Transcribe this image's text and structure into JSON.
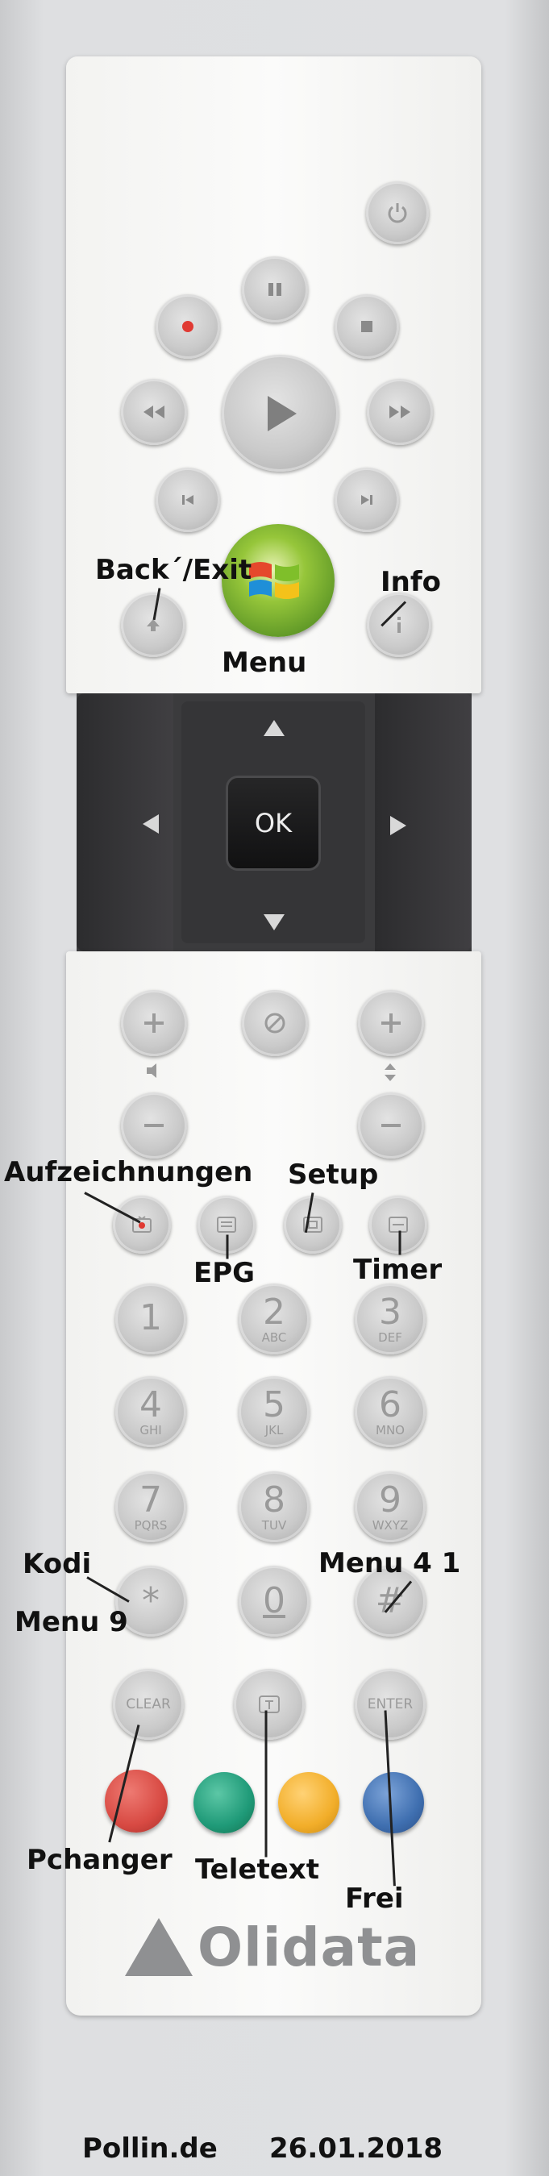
{
  "annotations": {
    "back_exit": "Back´/Exit",
    "info": "Info",
    "menu": "Menu",
    "aufzeichnungen": "Aufzeichnungen",
    "setup": "Setup",
    "epg": "EPG",
    "timer": "Timer",
    "kodi": "Kodi",
    "menu9": "Menu 9",
    "menu41": "Menu 4  1",
    "pchanger": "Pchanger",
    "teletext": "Teletext",
    "frei": "Frei"
  },
  "dpad": {
    "ok_label": "OK"
  },
  "keypad": [
    {
      "digit": "1",
      "letters": ""
    },
    {
      "digit": "2",
      "letters": "ABC"
    },
    {
      "digit": "3",
      "letters": "DEF"
    },
    {
      "digit": "4",
      "letters": "GHI"
    },
    {
      "digit": "5",
      "letters": "JKL"
    },
    {
      "digit": "6",
      "letters": "MNO"
    },
    {
      "digit": "7",
      "letters": "PQRS"
    },
    {
      "digit": "8",
      "letters": "TUV"
    },
    {
      "digit": "9",
      "letters": "WXYZ"
    }
  ],
  "special_keys": {
    "star": "*",
    "zero": "0",
    "hash": "#",
    "clear": "CLEAR",
    "enter": "ENTER"
  },
  "color_buttons": {
    "red": "#d84a43",
    "green": "#1f9a78",
    "yellow": "#f2ae2a",
    "blue": "#3f6fb0"
  },
  "brand": {
    "logo_text": "Olidata"
  },
  "footer": {
    "source": "Pollin.de",
    "date": "26.01.2018"
  },
  "icons": [
    "power-icon",
    "pause-icon",
    "record-icon",
    "stop-icon",
    "rewind-icon",
    "play-icon",
    "fast-forward-icon",
    "skip-back-icon",
    "skip-forward-icon",
    "windows-logo-icon",
    "back-icon",
    "info-icon",
    "volume-plus-icon",
    "mute-icon",
    "channel-plus-icon",
    "volume-minus-icon",
    "channel-minus-icon",
    "record-tv-icon",
    "guide-icon",
    "setup-icon",
    "timer-icon",
    "teletext-icon"
  ]
}
